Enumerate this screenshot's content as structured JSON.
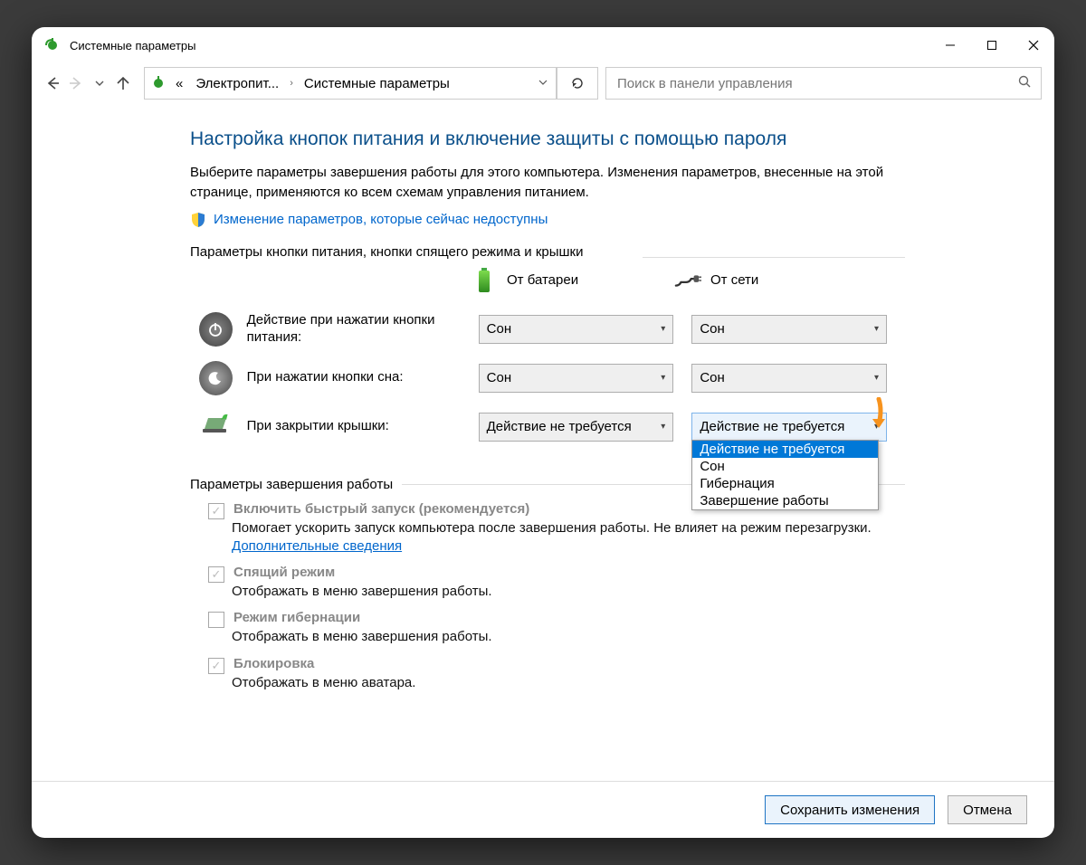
{
  "window_title": "Системные параметры",
  "breadcrumb": {
    "root_glyph": "«",
    "seg1": "Электропит...",
    "seg2": "Системные параметры"
  },
  "search_placeholder": "Поиск в панели управления",
  "page_heading": "Настройка кнопок питания и включение защиты с помощью пароля",
  "description": "Выберите параметры завершения работы для этого компьютера. Изменения параметров, внесенные на этой странице, применяются ко всем схемам управления питанием.",
  "admin_link": "Изменение параметров, которые сейчас недоступны",
  "section1_title": "Параметры кнопки питания, кнопки спящего режима и крышки",
  "col_battery": "От батареи",
  "col_plugged": "От сети",
  "rows": {
    "power_button": {
      "label": "Действие при нажатии кнопки питания:",
      "battery": "Сон",
      "plugged": "Сон"
    },
    "sleep_button": {
      "label": "При нажатии кнопки сна:",
      "battery": "Сон",
      "plugged": "Сон"
    },
    "lid_close": {
      "label": "При закрытии крышки:",
      "battery": "Действие не требуется",
      "plugged": "Действие не требуется"
    }
  },
  "dropdown_options": [
    "Действие не требуется",
    "Сон",
    "Гибернация",
    "Завершение работы"
  ],
  "section2_title": "Параметры завершения работы",
  "shutdown": {
    "fast_title": "Включить быстрый запуск (рекомендуется)",
    "fast_desc_a": "Помогает ускорить запуск компьютера после завершения работы. Не влияет на режим перезагрузки. ",
    "fast_link": "Дополнительные сведения",
    "sleep_title": "Спящий режим",
    "sleep_desc": "Отображать в меню завершения работы.",
    "hiber_title": "Режим гибернации",
    "hiber_desc": "Отображать в меню завершения работы.",
    "lock_title": "Блокировка",
    "lock_desc": "Отображать в меню аватара."
  },
  "buttons": {
    "save": "Сохранить изменения",
    "cancel": "Отмена"
  }
}
